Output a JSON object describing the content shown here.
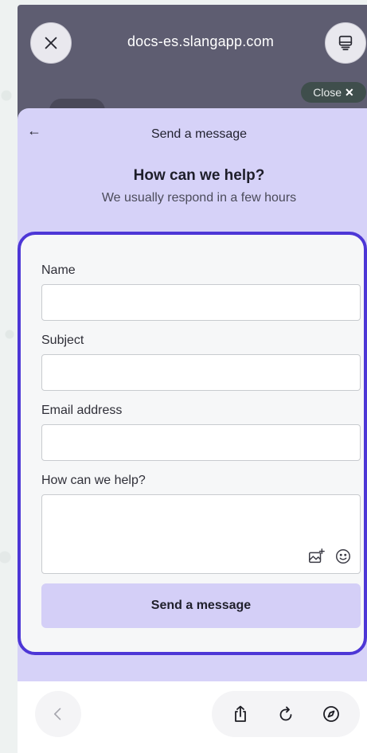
{
  "browser": {
    "url": "docs-es.slangapp.com",
    "close_label": "Close",
    "close_glyph": "✕"
  },
  "widget": {
    "back_glyph": "←",
    "header_title": "Send a message",
    "help_title": "How can we help?",
    "help_subtitle": "We usually respond in a few hours",
    "accent_color": "#4d37d6",
    "background_color": "#d6d2f8"
  },
  "form": {
    "name_label": "Name",
    "name_value": "",
    "subject_label": "Subject",
    "subject_value": "",
    "email_label": "Email address",
    "email_value": "",
    "message_label": "How can we help?",
    "message_value": "",
    "submit_label": "Send a message",
    "attachment_icon": "image-add-icon",
    "emoji_icon": "emoji-icon"
  },
  "bottom_bar": {
    "back_icon": "chevron-left-icon",
    "share_icon": "share-icon",
    "reload_icon": "reload-icon",
    "compass_icon": "compass-icon"
  }
}
